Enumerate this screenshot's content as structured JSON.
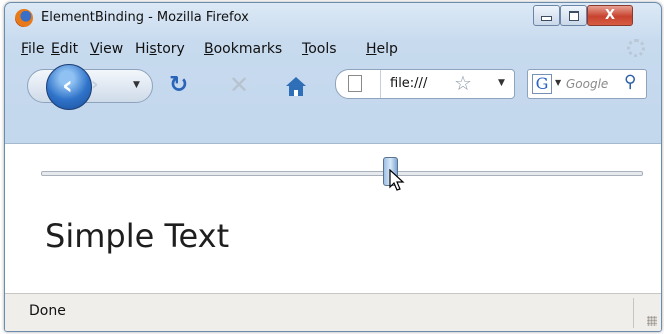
{
  "window": {
    "title": "ElementBinding - Mozilla Firefox",
    "controls": {
      "minimize": "",
      "maximize": "",
      "close": "X"
    }
  },
  "menubar": {
    "items": [
      {
        "label": "File",
        "accesskey": "F"
      },
      {
        "label": "Edit",
        "accesskey": "E"
      },
      {
        "label": "View",
        "accesskey": "V"
      },
      {
        "label": "History",
        "accesskey": "s"
      },
      {
        "label": "Bookmarks",
        "accesskey": "B"
      },
      {
        "label": "Tools",
        "accesskey": "T"
      },
      {
        "label": "Help",
        "accesskey": "H"
      }
    ]
  },
  "navbar": {
    "url": "file:///",
    "search_placeholder": "Google",
    "search_engine_icon": "G"
  },
  "content": {
    "slider": {
      "value_fraction": 0.58
    },
    "text": "Simple Text"
  },
  "statusbar": {
    "text": "Done"
  },
  "icons": {
    "app": "firefox-logo-icon",
    "back": "back-arrow-icon",
    "forward": "forward-arrow-icon",
    "reload": "reload-icon",
    "stop": "stop-icon",
    "home": "home-icon",
    "page": "page-icon",
    "bookmark": "star-icon",
    "search": "magnifier-icon"
  },
  "colors": {
    "window_frame": "#c7daee",
    "accent_blue": "#2f73c9",
    "close_red": "#c8432f"
  }
}
